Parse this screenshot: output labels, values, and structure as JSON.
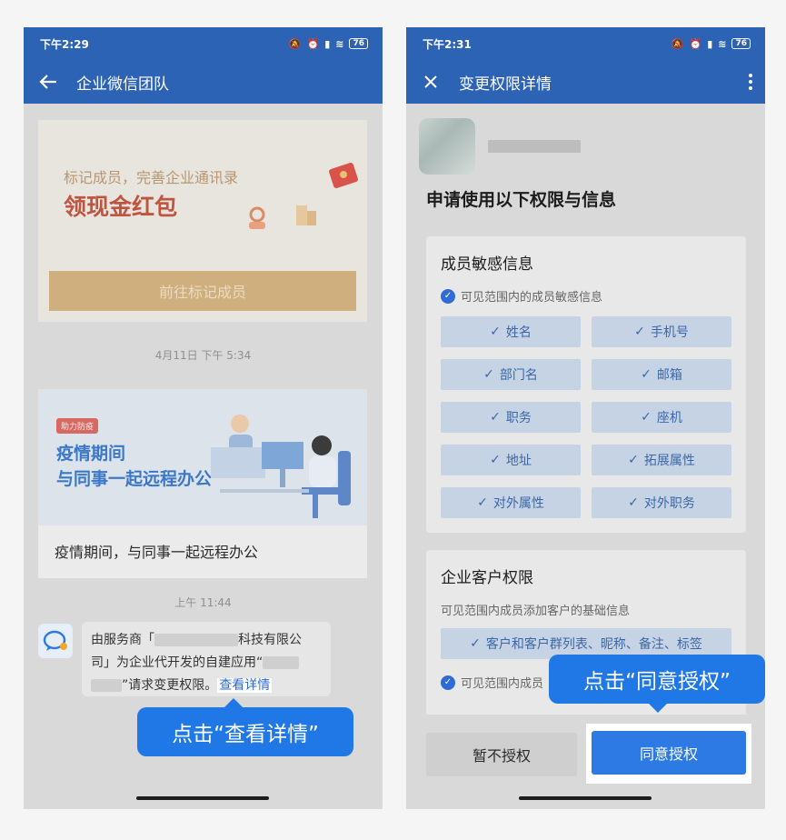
{
  "left": {
    "status": {
      "time": "下午2:29",
      "battery": "76"
    },
    "title": "企业微信团队",
    "promo": {
      "subtitle": "标记成员，完善企业通讯录",
      "headline": "领现金红包",
      "button": "前往标记成员"
    },
    "timestamp1": "4月11日 下午 5:34",
    "article": {
      "tag": "助力防疫",
      "headline_line1": "疫情期间",
      "headline_line2": "与同事一起远程办公",
      "caption": "疫情期间，与同事一起远程办公"
    },
    "timestamp2": "上午 11:44",
    "message": {
      "part1": "由服务商「",
      "part2": "科技有限公",
      "part3": "司」为企业代开发的自建应用“",
      "part4": "”请求变更权限。",
      "link": "查看详情"
    },
    "callout": "点击“查看详情”"
  },
  "right": {
    "status": {
      "time": "下午2:31",
      "battery": "76"
    },
    "title": "变更权限详情",
    "heading": "申请使用以下权限与信息",
    "section1": {
      "title": "成员敏感信息",
      "desc": "可见范围内的成员敏感信息",
      "chips": [
        "姓名",
        "手机号",
        "部门名",
        "邮箱",
        "职务",
        "座机",
        "地址",
        "拓展属性",
        "对外属性",
        "对外职务"
      ]
    },
    "section2": {
      "title": "企业客户权限",
      "desc": "可见范围内成员添加客户的基础信息",
      "chip": "客户和客户群列表、昵称、备注、标签",
      "desc2": "可见范围内成员"
    },
    "decline": "暂不授权",
    "accept": "同意授权",
    "callout": "点击“同意授权”"
  }
}
